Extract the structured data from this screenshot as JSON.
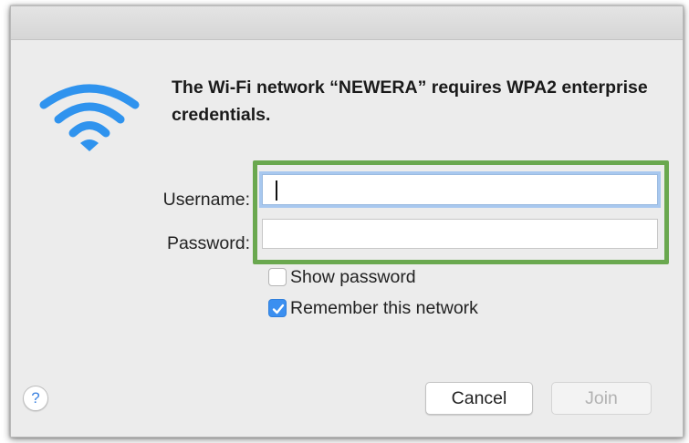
{
  "dialog": {
    "message": "The Wi-Fi network “NEWERA” requires WPA2 enterprise credentials.",
    "wifi_icon": "wifi-icon"
  },
  "form": {
    "username_label": "Username:",
    "username_value": "",
    "password_label": "Password:",
    "password_value": ""
  },
  "options": {
    "show_password_label": "Show password",
    "show_password_checked": false,
    "remember_label": "Remember this network",
    "remember_checked": true
  },
  "buttons": {
    "help_label": "?",
    "cancel_label": "Cancel",
    "join_label": "Join",
    "join_enabled": false
  },
  "colors": {
    "highlight": "#6aa84f",
    "accent": "#3b8ff0"
  }
}
